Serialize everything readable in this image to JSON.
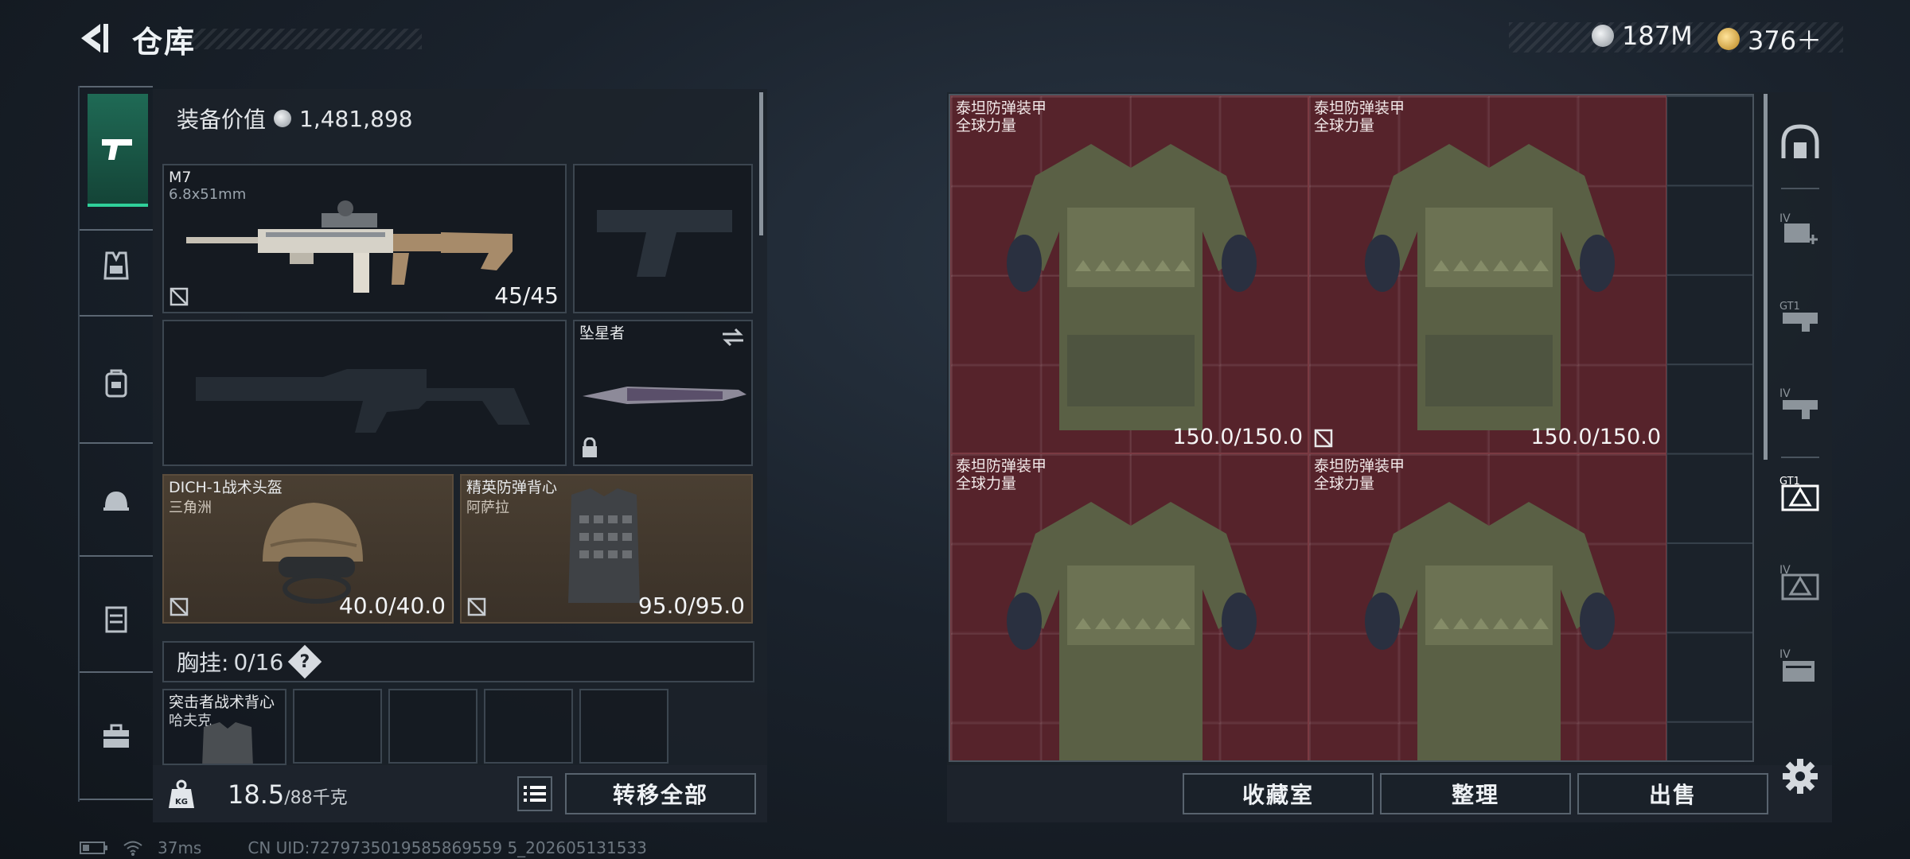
{
  "header": {
    "title": "仓库",
    "back_icon": "back-arrow-icon",
    "currencies": [
      {
        "icon": "silver-coin-icon",
        "amount": "187M",
        "color": "#c8ccd0"
      },
      {
        "icon": "gold-coin-icon",
        "amount": "376＋",
        "color": "#d9a63a"
      }
    ]
  },
  "rail": {
    "items": [
      {
        "icon": "pistol-icon",
        "active": true
      },
      {
        "icon": "vest-icon"
      },
      {
        "icon": "backpack-icon"
      },
      {
        "icon": "helmet-icon"
      },
      {
        "icon": "container-icon"
      },
      {
        "icon": "toolbox-icon"
      }
    ]
  },
  "equipment": {
    "value_label": "装备价值",
    "value": "1,481,898",
    "primary": {
      "name": "M7",
      "ammo": "6.8x51mm",
      "count": "45/45"
    },
    "melee": {
      "name": "坠星者"
    },
    "helmet": {
      "name": "DICH-1战术头盔",
      "sub": "三角洲",
      "durability": "40.0/40.0"
    },
    "armor": {
      "name": "精英防弹背心",
      "sub": "阿萨拉",
      "durability": "95.0/95.0"
    },
    "chest_label": "胸挂:",
    "chest_count": "0/16",
    "chest_help": "?",
    "backpack": {
      "name": "突击者战术背心",
      "sub": "哈夫克"
    }
  },
  "footer_left": {
    "weight_value": "18.5",
    "weight_max": "/88千克",
    "transfer_all": "转移全部"
  },
  "storage": {
    "items": [
      {
        "name": "泰坦防弹装甲",
        "sub": "全球力量",
        "durability": "150.0/150.0"
      },
      {
        "name": "泰坦防弹装甲",
        "sub": "全球力量",
        "durability": "150.0/150.0"
      },
      {
        "name": "泰坦防弹装甲",
        "sub": "全球力量",
        "durability": ""
      },
      {
        "name": "泰坦防弹装甲",
        "sub": "全球力量",
        "durability": ""
      }
    ],
    "item_color": "#6e242c"
  },
  "right_tabs": [
    "dome-icon",
    "medkit-iv-icon",
    "gear-gt1-icon",
    "weapon-iv-icon",
    "ammo-gt1-icon",
    "armor-iv-icon",
    "case-iv-icon"
  ],
  "footer_right": {
    "collect": "收藏室",
    "sort": "整理",
    "sell": "出售"
  },
  "status": {
    "ping": "37ms",
    "uid": "CN UID:7279735019585869559 5_202605131533"
  }
}
